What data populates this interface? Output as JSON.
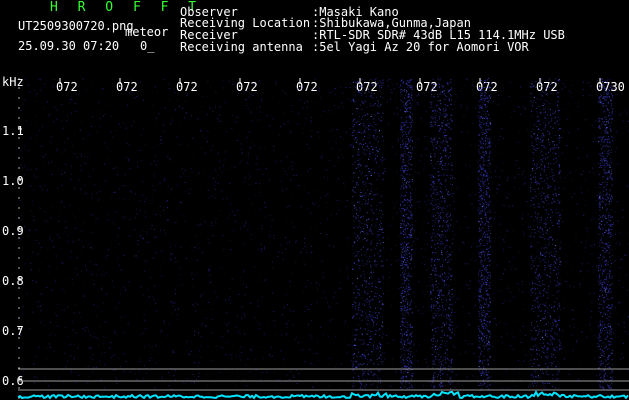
{
  "header": {
    "logo": "H R O F F T",
    "filename": "UT2509300720.png",
    "detector_label": "meteor",
    "datetime": "25.09.30 07:20",
    "count": "0_",
    "rows": [
      {
        "label": "Observer",
        "value": ":Masaki Kano"
      },
      {
        "label": "Receiving Location",
        "value": ":Shibukawa,Gunma,Japan"
      },
      {
        "label": "Receiver",
        "value": ":RTL-SDR SDR# 43dB L15 114.1MHz USB"
      },
      {
        "label": "Receiving antenna",
        "value": ":5el Yagi Az 20 for Aomori VOR"
      }
    ]
  },
  "axis": {
    "unit": "kHz",
    "freq_ticks": [
      "1.1",
      "1.0",
      "0.9",
      "0.8",
      "0.7",
      "0.6"
    ],
    "time_ticks": [
      "072",
      "072",
      "072",
      "072",
      "072",
      "072",
      "072",
      "072",
      "072",
      "0730"
    ]
  },
  "colors": {
    "background": "#000000",
    "noise": "#2020a0",
    "signal": "#5060ff",
    "baseline": "#00e5ff"
  }
}
